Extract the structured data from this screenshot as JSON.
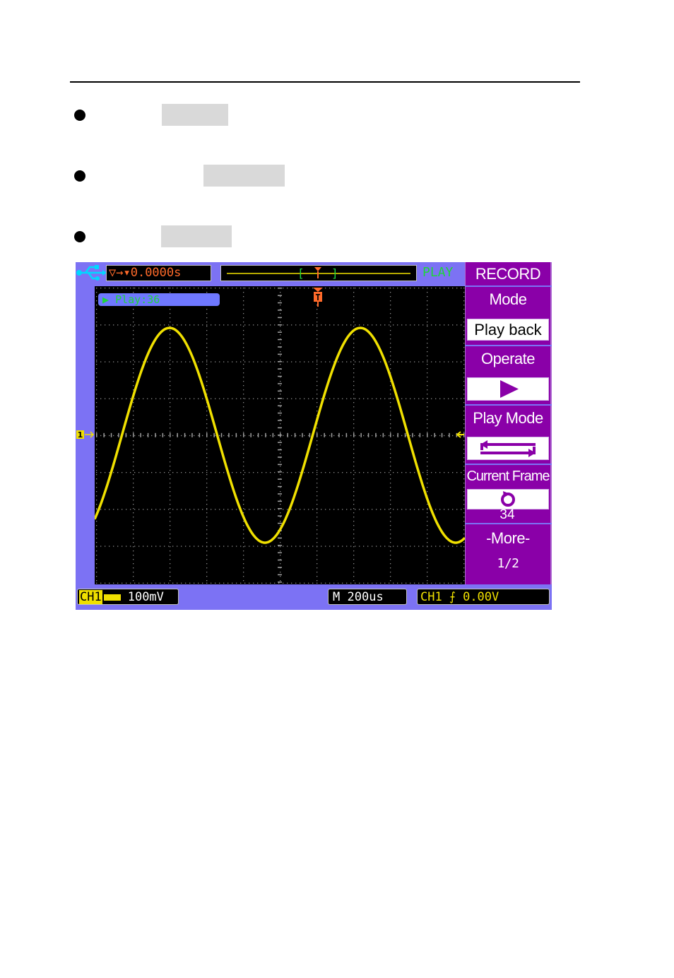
{
  "scope": {
    "trigger_position": "0.0000s",
    "run_status": "PLAY",
    "play_info": "Play:36",
    "menu": {
      "title": "RECORD",
      "mode_label": "Mode",
      "mode_value": "Play back",
      "operate_label": "Operate",
      "playmode_label": "Play Mode",
      "frame_label": "Current Frame",
      "frame_value": "34",
      "more_label": "-More-",
      "page": "1/2"
    },
    "status": {
      "ch_name": "CH1",
      "ch_scale": "100mV",
      "timebase_prefix": "M",
      "timebase": "200us",
      "trig_source": "CH1",
      "trig_level": "0.00V"
    },
    "channel_marker": "1",
    "trigger_marker": "T"
  },
  "colors": {
    "scope_frame": "#7c72f4",
    "menu_bg": "#8a00a8",
    "waveform": "#f0e000",
    "trigger": "#ff6a2a",
    "status_green": "#1ed53a"
  }
}
